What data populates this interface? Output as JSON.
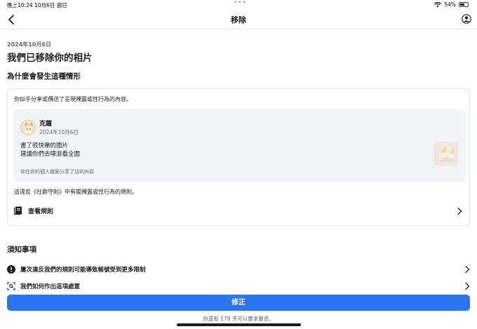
{
  "status_bar": {
    "time": "晚上10:24",
    "date": "10月6日 週日",
    "dots": "•••",
    "battery": "54%"
  },
  "nav": {
    "title": "移除"
  },
  "header": {
    "date": "2024年10月6日",
    "title": "我們已移除你的相片"
  },
  "why": {
    "heading": "為什麼會發生這種情形",
    "description": "你似乎分享或傳送了呈現裸露或性行為的內容。",
    "post": {
      "author": "克蘿",
      "date": "2024年10月6日",
      "line1": "畫了很快樂的圖片",
      "line2": "建議你們去噗浪看全圖",
      "note": "你在你的個人檔案分享了這則內容"
    },
    "violation": "這違反《社群守則》中有關裸露或性行為的規則。",
    "rules_link": "查看規則"
  },
  "notices": {
    "heading": "須知事項",
    "items": [
      {
        "label": "屢次違反我們的規則可能導致帳號受到更多限制",
        "icon": "alert-icon"
      },
      {
        "label": "我們如何作出這項處置",
        "icon": "review-search-icon"
      }
    ]
  },
  "footer": {
    "button": "修正",
    "note": "你還有 179 天可以要求審查。"
  },
  "colors": {
    "primary": "#2d74f0",
    "text": "#1c1e21",
    "secondary_text": "#65676b",
    "card_bg": "#f2f3f5"
  }
}
